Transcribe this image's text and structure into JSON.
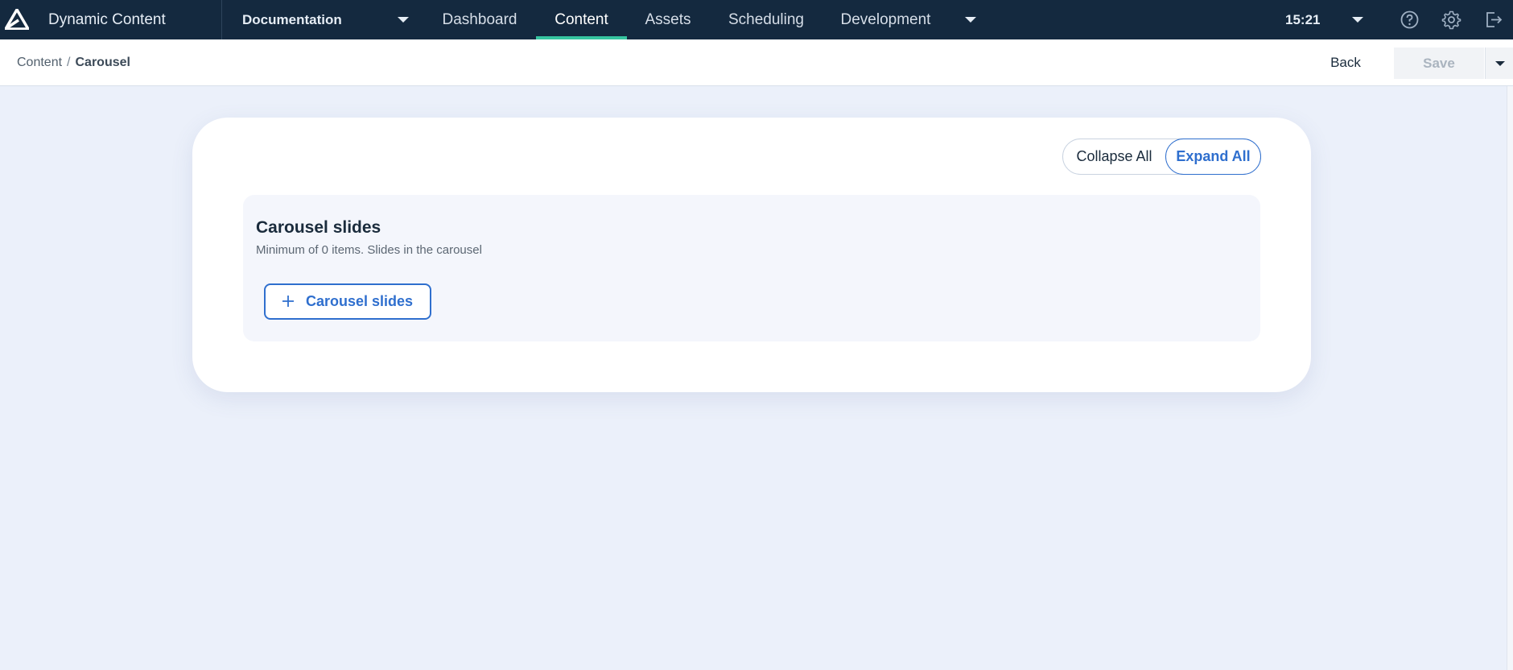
{
  "app": {
    "name": "Dynamic Content",
    "logo_icon": "amplience-logo-icon"
  },
  "hub": {
    "name": "Documentation"
  },
  "nav": {
    "tabs": [
      {
        "label": "Dashboard",
        "active": false
      },
      {
        "label": "Content",
        "active": true
      },
      {
        "label": "Assets",
        "active": false
      },
      {
        "label": "Scheduling",
        "active": false
      },
      {
        "label": "Development",
        "active": false
      }
    ],
    "clock": "15:21",
    "icons": [
      "help-icon",
      "gear-icon",
      "logout-icon"
    ]
  },
  "breadcrumb": {
    "root": "Content",
    "separator": "/",
    "current": "Carousel"
  },
  "actions": {
    "back_label": "Back",
    "save_label": "Save"
  },
  "editor": {
    "collapse_label": "Collapse All",
    "expand_label": "Expand All",
    "field": {
      "title": "Carousel slides",
      "description": "Minimum of 0 items. Slides in the carousel",
      "add_label": "Carousel slides"
    }
  },
  "colors": {
    "nav_bg": "#14293f",
    "accent": "#2f6fce",
    "active_tab_underline": "#36c4a0",
    "page_bg": "#ebf0fa"
  }
}
